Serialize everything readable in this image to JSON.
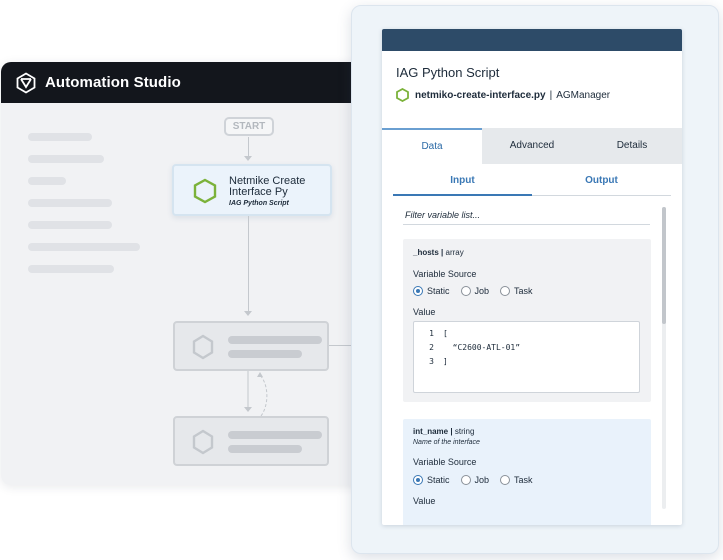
{
  "studio": {
    "title": "Automation Studio"
  },
  "workflow": {
    "start_label": "START",
    "active_node": {
      "title_line1": "Netmike Create",
      "title_line2": "Interface Py",
      "subtitle": "IAG Python Script"
    }
  },
  "panel": {
    "title": "IAG Python Script",
    "script_name": "netmiko-create-interface.py",
    "separator": "|",
    "manager": "AGManager",
    "tabs": [
      {
        "label": "Data",
        "active": true
      },
      {
        "label": "Advanced",
        "active": false
      },
      {
        "label": "Details",
        "active": false
      }
    ],
    "subtabs": [
      {
        "label": "Input",
        "active": true
      },
      {
        "label": "Output",
        "active": false
      }
    ],
    "filter_placeholder": "Filter variable list...",
    "variables": [
      {
        "name": "_hosts",
        "sep": "|",
        "type": "array",
        "source_label": "Variable Source",
        "options": [
          "Static",
          "Job",
          "Task"
        ],
        "selected": "Static",
        "value_label": "Value",
        "code": [
          {
            "n": "1",
            "text": "["
          },
          {
            "n": "2",
            "text": "  “C2600-ATL-01”"
          },
          {
            "n": "3",
            "text": "]"
          }
        ]
      },
      {
        "name": "int_name",
        "sep": "|",
        "type": "string",
        "description": "Name of the interface",
        "source_label": "Variable Source",
        "options": [
          "Static",
          "Job",
          "Task"
        ],
        "selected": "Static",
        "value_label": "Value"
      }
    ]
  },
  "colors": {
    "header_dark": "#13161c",
    "panel_topbar": "#2d4b68",
    "accent_blue": "#3a78b5",
    "hex_green": "#7bb23a"
  }
}
